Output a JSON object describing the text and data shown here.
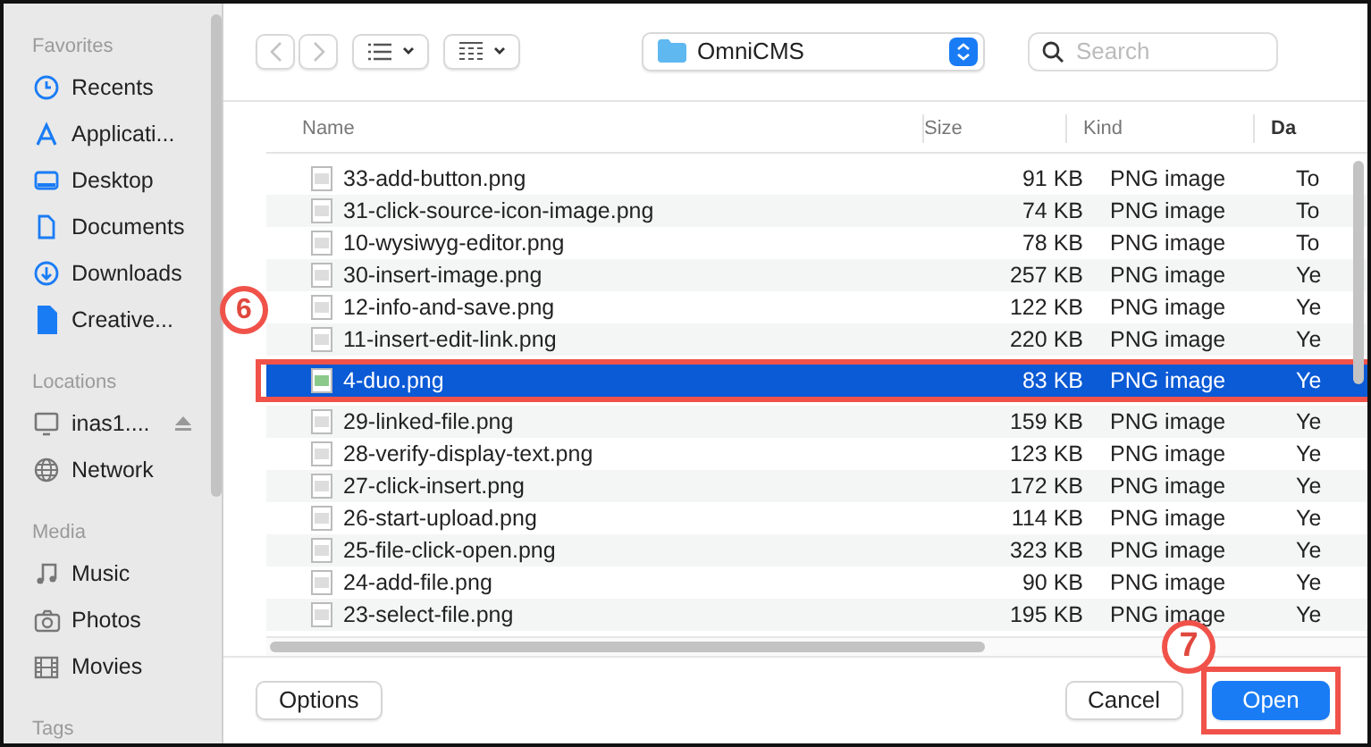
{
  "sidebar": {
    "sections": [
      {
        "title": "Favorites",
        "items": [
          {
            "label": "Recents"
          },
          {
            "label": "Applicati..."
          },
          {
            "label": "Desktop"
          },
          {
            "label": "Documents"
          },
          {
            "label": "Downloads"
          },
          {
            "label": "Creative..."
          }
        ]
      },
      {
        "title": "Locations",
        "items": [
          {
            "label": "inas1....",
            "ejectable": true
          },
          {
            "label": "Network"
          }
        ]
      },
      {
        "title": "Media",
        "items": [
          {
            "label": "Music"
          },
          {
            "label": "Photos"
          },
          {
            "label": "Movies"
          }
        ]
      },
      {
        "title": "Tags"
      }
    ]
  },
  "toolbar": {
    "location": "OmniCMS",
    "search": {
      "placeholder": "Search"
    }
  },
  "table": {
    "columns": [
      "Name",
      "Size",
      "Kind",
      "Da"
    ],
    "rows": [
      {
        "name": "33-add-button.png",
        "size": "91 KB",
        "kind": "PNG image",
        "date": "To",
        "selected": false
      },
      {
        "name": "31-click-source-icon-image.png",
        "size": "74 KB",
        "kind": "PNG image",
        "date": "To",
        "selected": false
      },
      {
        "name": "10-wysiwyg-editor.png",
        "size": "78 KB",
        "kind": "PNG image",
        "date": "To",
        "selected": false
      },
      {
        "name": "30-insert-image.png",
        "size": "257 KB",
        "kind": "PNG image",
        "date": "Ye",
        "selected": false
      },
      {
        "name": "12-info-and-save.png",
        "size": "122 KB",
        "kind": "PNG image",
        "date": "Ye",
        "selected": false
      },
      {
        "name": "11-insert-edit-link.png",
        "size": "220 KB",
        "kind": "PNG image",
        "date": "Ye",
        "selected": false
      },
      {
        "name": "4-duo.png",
        "size": "83 KB",
        "kind": "PNG image",
        "date": "Ye",
        "selected": true
      },
      {
        "name": "29-linked-file.png",
        "size": "159 KB",
        "kind": "PNG image",
        "date": "Ye",
        "selected": false
      },
      {
        "name": "28-verify-display-text.png",
        "size": "123 KB",
        "kind": "PNG image",
        "date": "Ye",
        "selected": false
      },
      {
        "name": "27-click-insert.png",
        "size": "172 KB",
        "kind": "PNG image",
        "date": "Ye",
        "selected": false
      },
      {
        "name": "26-start-upload.png",
        "size": "114 KB",
        "kind": "PNG image",
        "date": "Ye",
        "selected": false
      },
      {
        "name": "25-file-click-open.png",
        "size": "323 KB",
        "kind": "PNG image",
        "date": "Ye",
        "selected": false
      },
      {
        "name": "24-add-file.png",
        "size": "90 KB",
        "kind": "PNG image",
        "date": "Ye",
        "selected": false
      },
      {
        "name": "23-select-file.png",
        "size": "195 KB",
        "kind": "PNG image",
        "date": "Ye",
        "selected": false
      }
    ]
  },
  "footer": {
    "options": "Options",
    "cancel": "Cancel",
    "open": "Open"
  },
  "callouts": [
    {
      "label": "6"
    },
    {
      "label": "7"
    }
  ]
}
